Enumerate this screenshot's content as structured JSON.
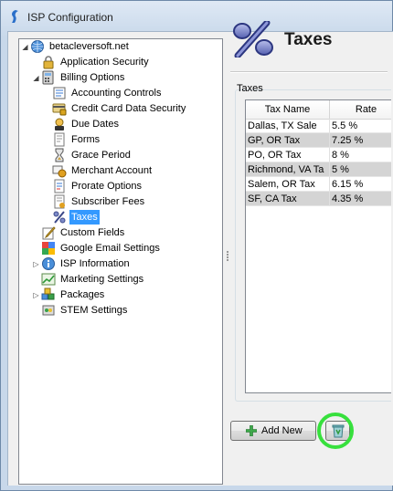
{
  "window": {
    "title": "ISP Configuration"
  },
  "tree": {
    "root": {
      "label": "betacleversoft.net",
      "icon": "globe-icon"
    },
    "items": [
      {
        "key": "application-security",
        "label": "Application Security",
        "icon": "lock-icon"
      },
      {
        "key": "billing-options",
        "label": "Billing Options",
        "icon": "calculator-icon"
      },
      {
        "key": "accounting-controls",
        "label": "Accounting Controls",
        "icon": "accounting-icon"
      },
      {
        "key": "credit-card-data-security",
        "label": "Credit Card Data Security",
        "icon": "credit-card-icon"
      },
      {
        "key": "due-dates",
        "label": "Due Dates",
        "icon": "due-dates-icon"
      },
      {
        "key": "forms",
        "label": "Forms",
        "icon": "forms-icon"
      },
      {
        "key": "grace-period",
        "label": "Grace Period",
        "icon": "hourglass-icon"
      },
      {
        "key": "merchant-account",
        "label": "Merchant Account",
        "icon": "merchant-icon"
      },
      {
        "key": "prorate-options",
        "label": "Prorate Options",
        "icon": "prorate-icon"
      },
      {
        "key": "subscriber-fees",
        "label": "Subscriber Fees",
        "icon": "fees-icon"
      },
      {
        "key": "taxes",
        "label": "Taxes",
        "icon": "percent-icon"
      },
      {
        "key": "custom-fields",
        "label": "Custom Fields",
        "icon": "pencil-icon"
      },
      {
        "key": "google-email-settings",
        "label": "Google Email Settings",
        "icon": "google-icon"
      },
      {
        "key": "isp-information",
        "label": "ISP Information",
        "icon": "info-icon"
      },
      {
        "key": "marketing-settings",
        "label": "Marketing Settings",
        "icon": "chart-icon"
      },
      {
        "key": "packages",
        "label": "Packages",
        "icon": "packages-icon"
      },
      {
        "key": "stem-settings",
        "label": "STEM Settings",
        "icon": "stem-icon"
      }
    ],
    "selected": "Taxes"
  },
  "header": {
    "title": "Taxes",
    "icon": "percent-icon"
  },
  "taxes_group": {
    "label": "Taxes",
    "columns": [
      "Tax Name",
      "Rate"
    ],
    "rows": [
      {
        "name": "Dallas, TX Sale",
        "rate": "5.5 %"
      },
      {
        "name": "GP, OR Tax",
        "rate": "7.25 %"
      },
      {
        "name": "PO, OR Tax",
        "rate": "8 %"
      },
      {
        "name": "Richmond, VA Ta",
        "rate": "5 %"
      },
      {
        "name": "Salem, OR Tax",
        "rate": "6.15 %"
      },
      {
        "name": "SF, CA Tax",
        "rate": "4.35 %"
      }
    ]
  },
  "buttons": {
    "add_label": "Add New",
    "add_icon": "plus-icon",
    "delete_icon": "recycle-bin-icon"
  },
  "colors": {
    "selection": "#3399ff",
    "alt_row": "#d4d4d4",
    "highlight_ring": "#37e03d"
  }
}
